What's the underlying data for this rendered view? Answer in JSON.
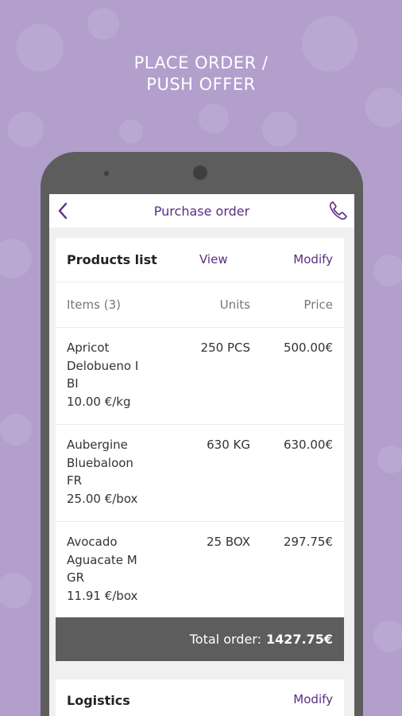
{
  "headline": {
    "line1": "PLACE ORDER /",
    "line2": "PUSH OFFER"
  },
  "appbar": {
    "title": "Purchase order",
    "back_icon": "chevron-left-icon",
    "call_icon": "phone-icon"
  },
  "products": {
    "title": "Products list",
    "view_label": "View",
    "modify_label": "Modify",
    "columns": {
      "items": "Items (3)",
      "units": "Units",
      "price": "Price"
    },
    "rows": [
      {
        "name": [
          "Apricot",
          "Delobueno I",
          "BI"
        ],
        "unit_price": "10.00 €/kg",
        "units": "250 PCS",
        "price": "500.00€"
      },
      {
        "name": [
          "Aubergine",
          "Bluebaloon",
          "FR"
        ],
        "unit_price": "25.00 €/box",
        "units": "630 KG",
        "price": "630.00€"
      },
      {
        "name": [
          "Avocado",
          "Aguacate M",
          "GR"
        ],
        "unit_price": "11.91 €/box",
        "units": "25 BOX",
        "price": "297.75€"
      }
    ]
  },
  "total": {
    "label": "Total order:",
    "value": "1427.75€"
  },
  "logistics": {
    "title": "Logistics",
    "modify_label": "Modify"
  },
  "colors": {
    "background": "#b29fcc",
    "accent": "#5a2d82",
    "device": "#5d5d5d"
  }
}
